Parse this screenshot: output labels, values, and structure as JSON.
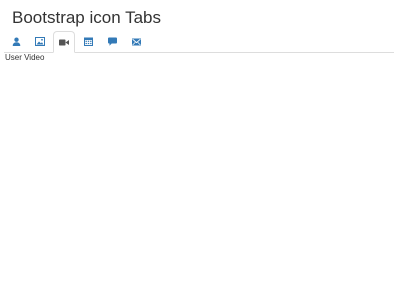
{
  "page": {
    "title": "Bootstrap icon Tabs"
  },
  "tabs": [
    {
      "icon": "user-icon",
      "active": false
    },
    {
      "icon": "picture-icon",
      "active": false
    },
    {
      "icon": "facetime-video-icon",
      "active": true
    },
    {
      "icon": "calendar-icon",
      "active": false
    },
    {
      "icon": "comment-icon",
      "active": false
    },
    {
      "icon": "envelope-icon",
      "active": false
    }
  ],
  "active_pane": {
    "text": "User Video"
  },
  "colors": {
    "link_blue": "#337ab7",
    "active_icon": "#555555",
    "border": "#dddddd",
    "text": "#333333"
  }
}
